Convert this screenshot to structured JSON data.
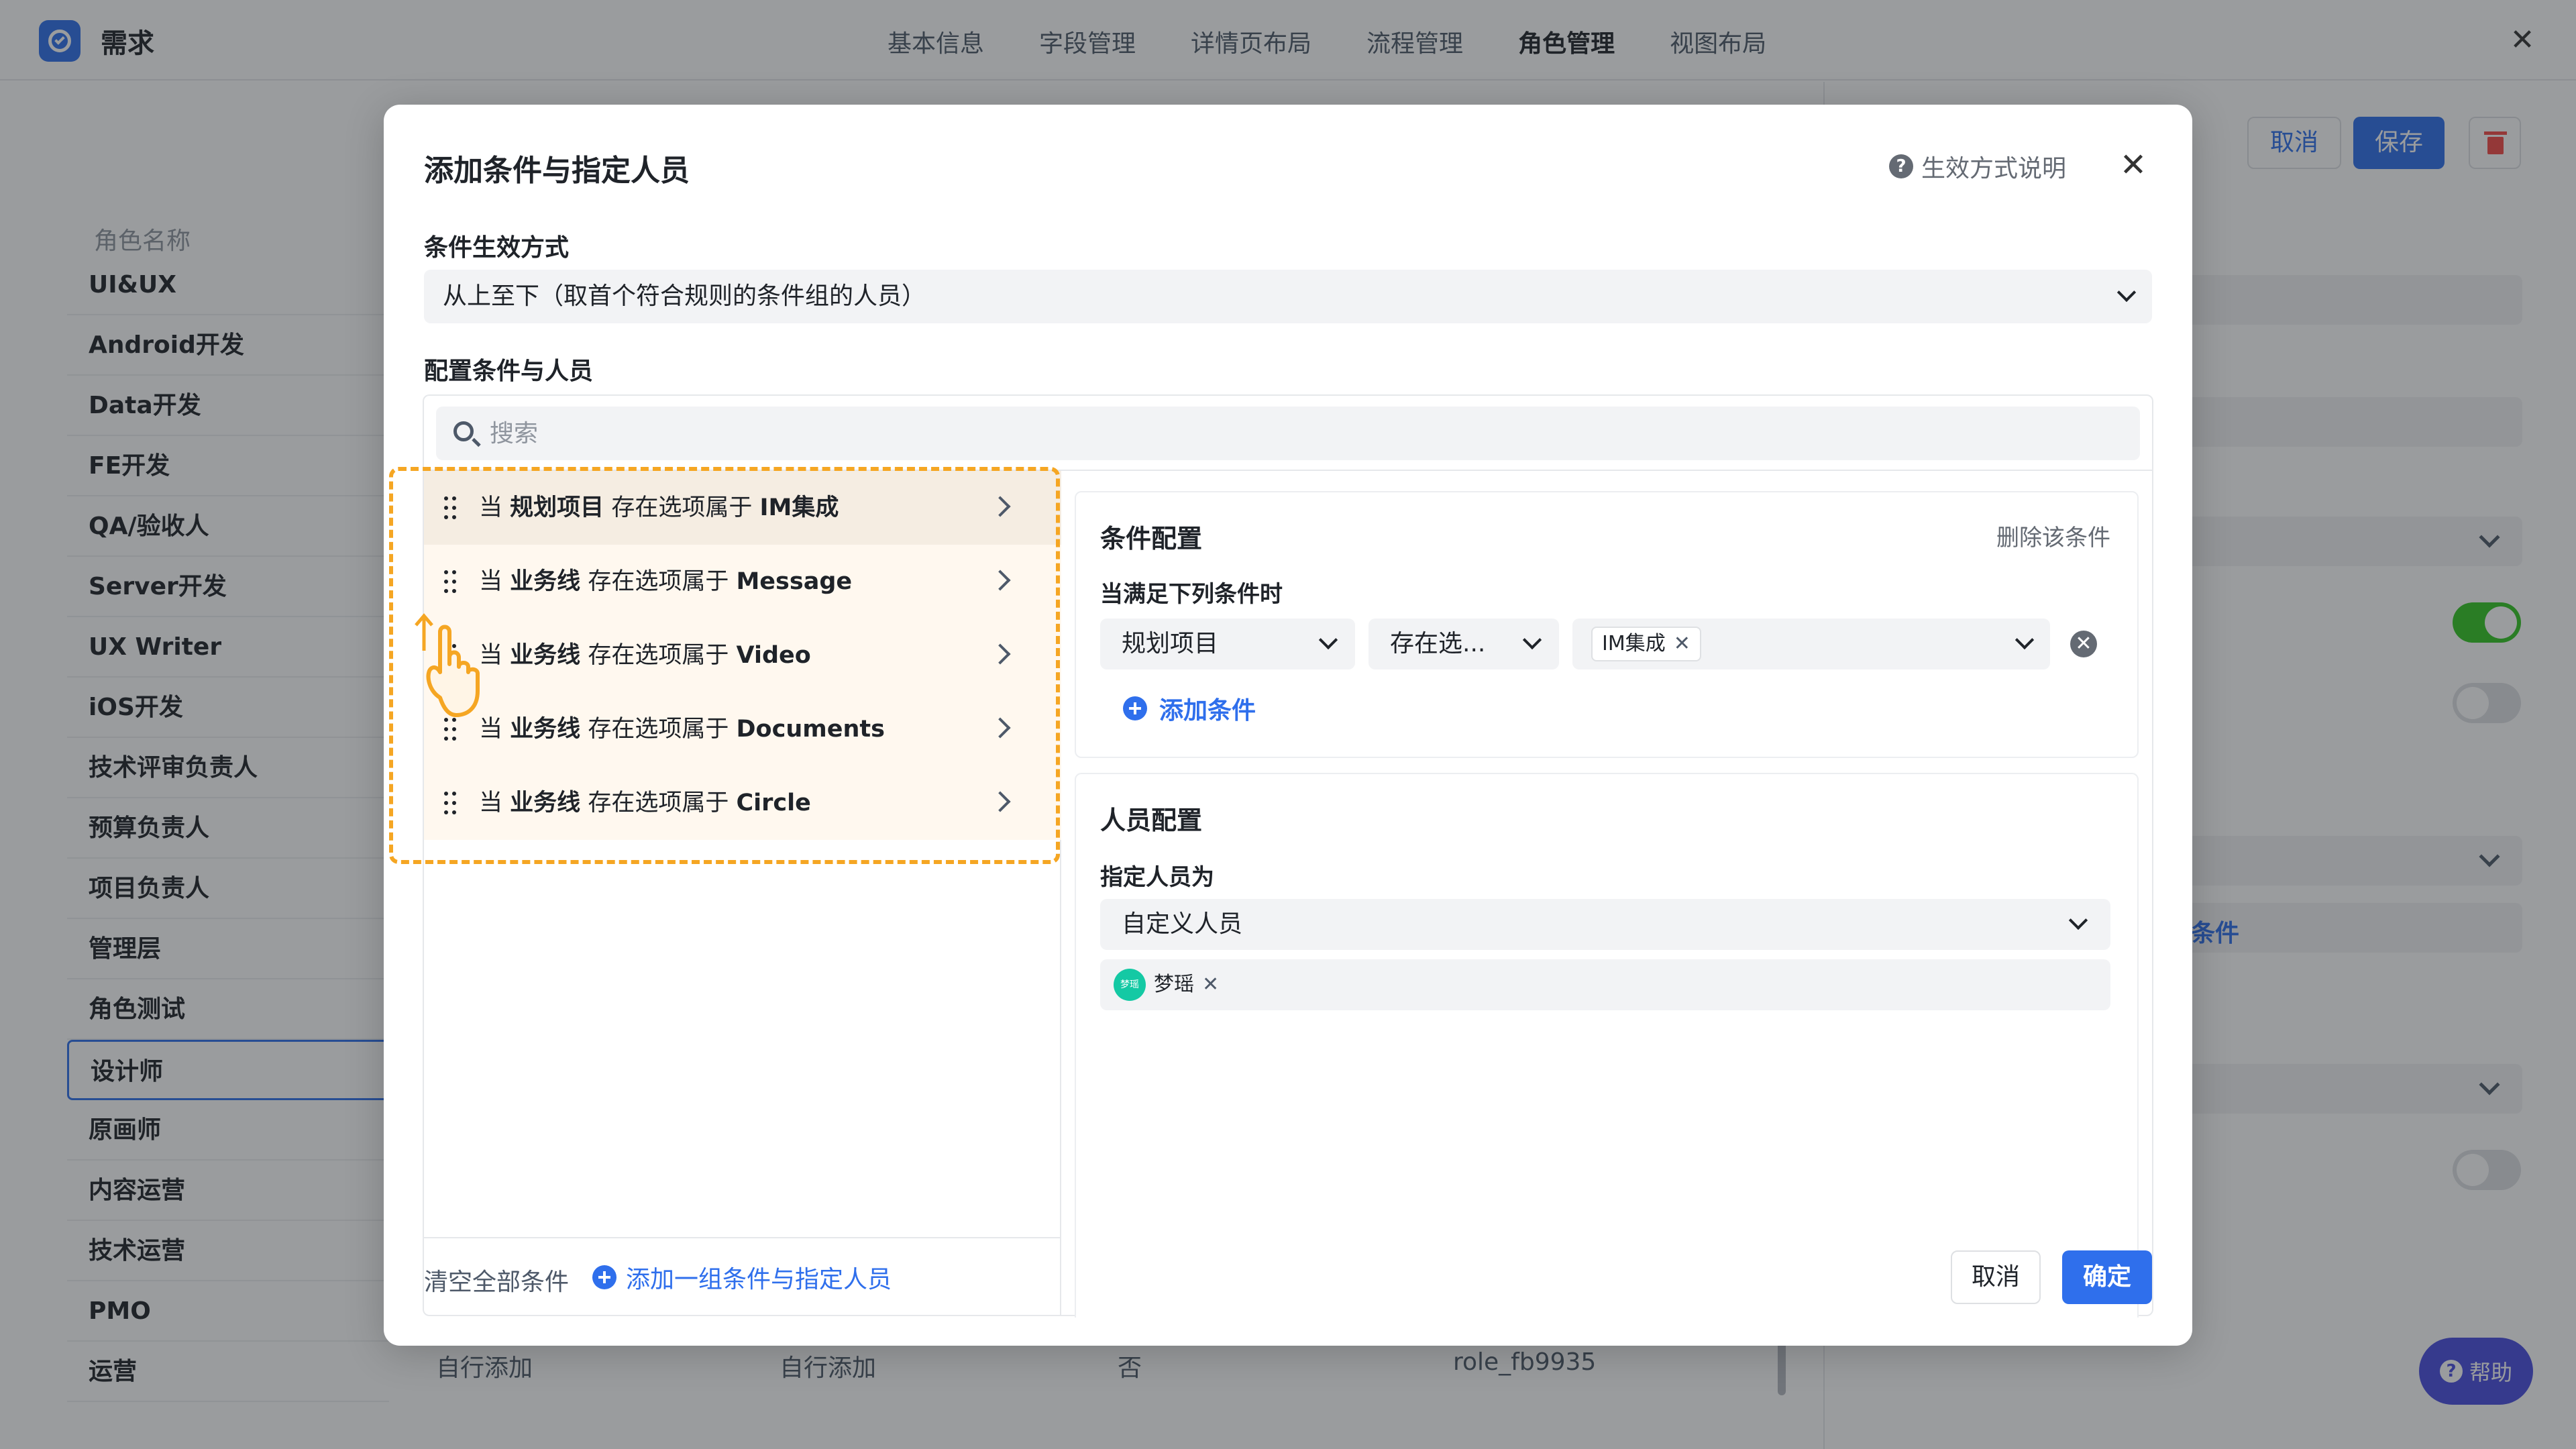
{
  "header": {
    "app_title": "需求",
    "tabs": [
      "基本信息",
      "字段管理",
      "详情页布局",
      "流程管理",
      "角色管理",
      "视图布局"
    ],
    "active_tab": "角色管理"
  },
  "background": {
    "role_header": "角色名称",
    "roles": [
      "UI&UX",
      "Android开发",
      "Data开发",
      "FE开发",
      "QA/验收人",
      "Server开发",
      "UX Writer",
      "iOS开发",
      "技术评审负责人",
      "预算负责人",
      "项目负责人",
      "管理层",
      "角色测试",
      "设计师",
      "原画师",
      "内容运营",
      "技术运营",
      "PMO",
      "运营"
    ],
    "active_role": "设计师",
    "bottom_row": [
      "自行添加",
      "自行添加",
      "否",
      "role_fb9935"
    ],
    "right_cancel": "取消",
    "right_save": "保存",
    "right_link": "条件",
    "help_label": "帮助"
  },
  "modal": {
    "title": "添加条件与指定人员",
    "help_text": "生效方式说明",
    "mode_label": "条件生效方式",
    "mode_value": "从上至下（取首个符合规则的条件组的人员）",
    "config_label": "配置条件与人员",
    "search_placeholder": "搜索",
    "conditions": [
      {
        "prefix": "当",
        "field": "规划项目",
        "op": "存在选项属于",
        "value": "IM集成"
      },
      {
        "prefix": "当",
        "field": "业务线",
        "op": "存在选项属于",
        "value": "Message"
      },
      {
        "prefix": "当",
        "field": "业务线",
        "op": "存在选项属于",
        "value": "Video"
      },
      {
        "prefix": "当",
        "field": "业务线",
        "op": "存在选项属于",
        "value": "Documents"
      },
      {
        "prefix": "当",
        "field": "业务线",
        "op": "存在选项属于",
        "value": "Circle"
      }
    ],
    "add_group": "添加一组条件与指定人员",
    "condition_panel": {
      "title": "条件配置",
      "delete_link": "删除该条件",
      "when_label": "当满足下列条件时",
      "field_select": "规划项目",
      "op_select": "存在选...",
      "value_tag": "IM集成",
      "add_condition": "添加条件"
    },
    "person_panel": {
      "title": "人员配置",
      "assign_label": "指定人员为",
      "assign_select": "自定义人员",
      "person_avatar_text": "梦瑶",
      "person_name": "梦瑶"
    },
    "clear_all": "清空全部条件",
    "cancel": "取消",
    "confirm": "确定"
  },
  "colors": {
    "accent": "#2f6fec",
    "highlight": "#f5a623",
    "toggle_on": "#34c724"
  }
}
